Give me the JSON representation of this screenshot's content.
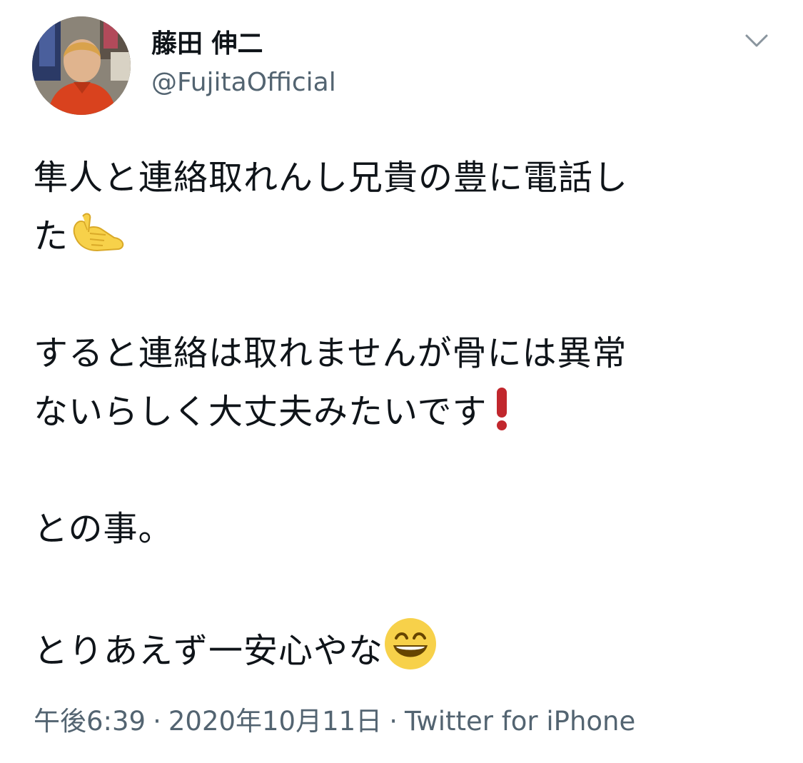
{
  "user": {
    "display_name": "藤田 伸二",
    "handle": "@FujitaOfficial"
  },
  "tweet": {
    "line1": "隼人と連絡取れんし兄貴の豊に電話し",
    "line2": "た",
    "line3": "すると連絡は取れませんが骨には異常",
    "line4": "ないらしく大丈夫みたいです",
    "line5": "との事。",
    "line6": "とりあえず一安心やな"
  },
  "meta": {
    "time": "午後6:39",
    "separator": "·",
    "date": "2020年10月11日",
    "client": "Twitter for iPhone"
  },
  "icons": {
    "call_me_hand": "call-me-hand-emoji",
    "exclamation": "red-exclamation-emoji",
    "grin": "grinning-face-emoji",
    "more": "chevron-down-icon"
  },
  "colors": {
    "text": "#0f1419",
    "secondary": "#536471",
    "exclamation": "#c1272d",
    "emoji_yellow": "#f7d14a"
  }
}
